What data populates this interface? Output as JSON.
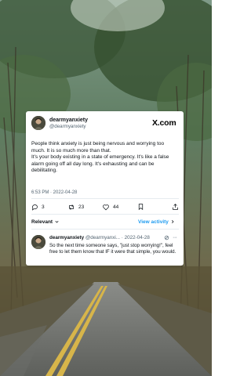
{
  "post": {
    "display_name": "dearmyanxiety",
    "handle": "@dearmyanxiety",
    "platform_logo": "X.com",
    "body_paragraph_1": "People think anxiety is just being nervous and worrying too much. It is so much more than that.",
    "body_paragraph_2": "It's your body existing in a state of emergency. It's like a false alarm going off all day long. It's exhausting and can be debilitating.",
    "timestamp": "6:53 PM · 2022-04-28",
    "stats": {
      "replies": "3",
      "reposts": "23",
      "likes": "44"
    }
  },
  "replies_bar": {
    "sort_label": "Relevant",
    "view_activity_label": "View activity"
  },
  "reply": {
    "display_name": "dearmyanxiety",
    "meta": "@dearmyanxi... · 2022-04-28",
    "text": "So the next time someone says, \"just stop worrying!\", feel free to let them know that IF it were that simple, you would."
  },
  "colors": {
    "accent": "#1d9bf0",
    "text_primary": "#0f1419",
    "text_secondary": "#536471",
    "card_background": "#ffffff"
  },
  "icons": [
    "reply-icon",
    "repost-icon",
    "like-icon",
    "bookmark-icon",
    "share-icon",
    "chevron-down-icon",
    "chevron-right-icon",
    "more-icon"
  ]
}
